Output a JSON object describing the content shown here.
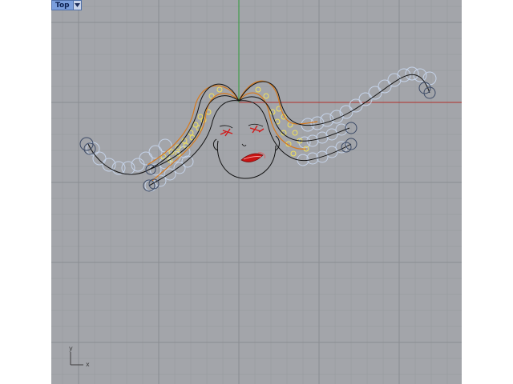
{
  "viewport": {
    "name": "Top",
    "dropdown_icon": "triangle-down-icon",
    "colors": {
      "background": "#a3a5aa",
      "grid_minor": "#999ca1",
      "grid_major": "#8a8d92",
      "axis_x": "#b0302a",
      "axis_y": "#2f9a3a",
      "curve": "#111111",
      "hair_outline": "#d87a1c",
      "control_points_yellow": "#f2e25a",
      "control_points_blue": "#c9d8f0",
      "circle_outline": "#3c4a66",
      "eye_mark": "#d11a1a",
      "lips": "#c81414"
    }
  },
  "axis_widget": {
    "x_label": "x",
    "y_label": "y"
  }
}
